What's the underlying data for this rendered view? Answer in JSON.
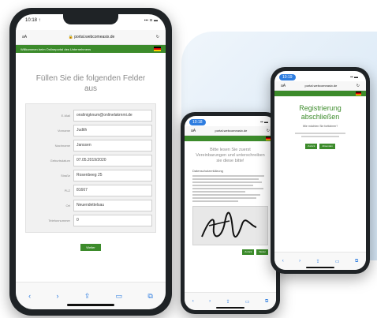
{
  "phone1": {
    "time": "10:18 ↑",
    "signal": "▪▪▪ ≋ ▬",
    "url_prefix": "aA",
    "url": "portal.webcomeasix.de",
    "greenbar_text": "Willkommen beim Onlineportal des Unternehmens",
    "heading": "Füllen Sie die folgenden Felder aus",
    "fields": [
      {
        "label": "E-Mail",
        "value": "onslinigknum@onlinelakrnmi.de"
      },
      {
        "label": "Vorname",
        "value": "Judith"
      },
      {
        "label": "Nachname",
        "value": "Janssen"
      },
      {
        "label": "Geburtsdatum",
        "value": "07.05.2019/2020"
      },
      {
        "label": "Straße",
        "value": "Rosenbeeg 25"
      },
      {
        "label": "PLZ",
        "value": "81667"
      },
      {
        "label": "Ort",
        "value": "Neuendettelsau"
      },
      {
        "label": "Telefonnummer",
        "value": "0"
      }
    ],
    "submit_label": "Weiter",
    "toolbar_icons": [
      "back-icon",
      "forward-icon",
      "share-icon",
      "bookmarks-icon",
      "tabs-icon"
    ]
  },
  "phone2": {
    "status_pill": "10:18",
    "url_prefix": "aA",
    "url": "portal.webcomeasix.de",
    "heading": "Bitte lesen Sie zuerst Vereinbarungen und unterschreiben sie diese bitte!",
    "section_title": "Datenschutzerklärung",
    "buttons": [
      "Zurück",
      "Weiter"
    ]
  },
  "phone3": {
    "status_pill": "10:19",
    "url_prefix": "aA",
    "url": "portal.webcomeasix.de",
    "title": "Registrierung abschließen",
    "subtitle": "Wie möchten Sie fortfahren?",
    "buttons": [
      "Zurück",
      "Absenden"
    ]
  },
  "colors": {
    "brand_green": "#3c8b2b",
    "ios_blue": "#2e7de0"
  }
}
